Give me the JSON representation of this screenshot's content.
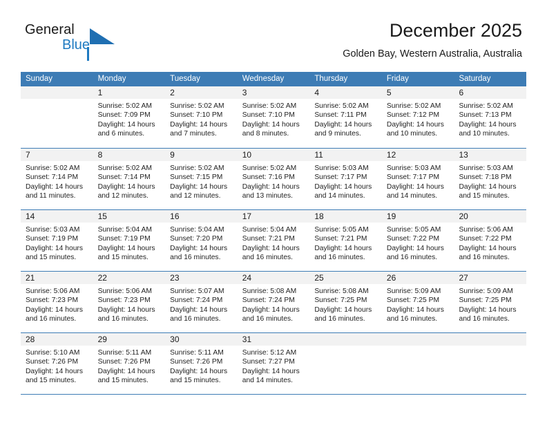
{
  "brand": {
    "name_part1": "General",
    "name_part2": "Blue",
    "mark_icon": "triangle-flag-icon",
    "accent_color": "#1f7ac1"
  },
  "header": {
    "title": "December 2025",
    "subtitle": "Golden Bay, Western Australia, Australia"
  },
  "calendar": {
    "header_bg_color": "#3d7cb5",
    "daynum_band_color": "#f2f2f2",
    "weekdays": [
      "Sunday",
      "Monday",
      "Tuesday",
      "Wednesday",
      "Thursday",
      "Friday",
      "Saturday"
    ],
    "weeks": [
      [
        {
          "day": "",
          "lines": []
        },
        {
          "day": "1",
          "lines": [
            "Sunrise: 5:02 AM",
            "Sunset: 7:09 PM",
            "Daylight: 14 hours",
            "and 6 minutes."
          ]
        },
        {
          "day": "2",
          "lines": [
            "Sunrise: 5:02 AM",
            "Sunset: 7:10 PM",
            "Daylight: 14 hours",
            "and 7 minutes."
          ]
        },
        {
          "day": "3",
          "lines": [
            "Sunrise: 5:02 AM",
            "Sunset: 7:10 PM",
            "Daylight: 14 hours",
            "and 8 minutes."
          ]
        },
        {
          "day": "4",
          "lines": [
            "Sunrise: 5:02 AM",
            "Sunset: 7:11 PM",
            "Daylight: 14 hours",
            "and 9 minutes."
          ]
        },
        {
          "day": "5",
          "lines": [
            "Sunrise: 5:02 AM",
            "Sunset: 7:12 PM",
            "Daylight: 14 hours",
            "and 10 minutes."
          ]
        },
        {
          "day": "6",
          "lines": [
            "Sunrise: 5:02 AM",
            "Sunset: 7:13 PM",
            "Daylight: 14 hours",
            "and 10 minutes."
          ]
        }
      ],
      [
        {
          "day": "7",
          "lines": [
            "Sunrise: 5:02 AM",
            "Sunset: 7:14 PM",
            "Daylight: 14 hours",
            "and 11 minutes."
          ]
        },
        {
          "day": "8",
          "lines": [
            "Sunrise: 5:02 AM",
            "Sunset: 7:14 PM",
            "Daylight: 14 hours",
            "and 12 minutes."
          ]
        },
        {
          "day": "9",
          "lines": [
            "Sunrise: 5:02 AM",
            "Sunset: 7:15 PM",
            "Daylight: 14 hours",
            "and 12 minutes."
          ]
        },
        {
          "day": "10",
          "lines": [
            "Sunrise: 5:02 AM",
            "Sunset: 7:16 PM",
            "Daylight: 14 hours",
            "and 13 minutes."
          ]
        },
        {
          "day": "11",
          "lines": [
            "Sunrise: 5:03 AM",
            "Sunset: 7:17 PM",
            "Daylight: 14 hours",
            "and 14 minutes."
          ]
        },
        {
          "day": "12",
          "lines": [
            "Sunrise: 5:03 AM",
            "Sunset: 7:17 PM",
            "Daylight: 14 hours",
            "and 14 minutes."
          ]
        },
        {
          "day": "13",
          "lines": [
            "Sunrise: 5:03 AM",
            "Sunset: 7:18 PM",
            "Daylight: 14 hours",
            "and 15 minutes."
          ]
        }
      ],
      [
        {
          "day": "14",
          "lines": [
            "Sunrise: 5:03 AM",
            "Sunset: 7:19 PM",
            "Daylight: 14 hours",
            "and 15 minutes."
          ]
        },
        {
          "day": "15",
          "lines": [
            "Sunrise: 5:04 AM",
            "Sunset: 7:19 PM",
            "Daylight: 14 hours",
            "and 15 minutes."
          ]
        },
        {
          "day": "16",
          "lines": [
            "Sunrise: 5:04 AM",
            "Sunset: 7:20 PM",
            "Daylight: 14 hours",
            "and 16 minutes."
          ]
        },
        {
          "day": "17",
          "lines": [
            "Sunrise: 5:04 AM",
            "Sunset: 7:21 PM",
            "Daylight: 14 hours",
            "and 16 minutes."
          ]
        },
        {
          "day": "18",
          "lines": [
            "Sunrise: 5:05 AM",
            "Sunset: 7:21 PM",
            "Daylight: 14 hours",
            "and 16 minutes."
          ]
        },
        {
          "day": "19",
          "lines": [
            "Sunrise: 5:05 AM",
            "Sunset: 7:22 PM",
            "Daylight: 14 hours",
            "and 16 minutes."
          ]
        },
        {
          "day": "20",
          "lines": [
            "Sunrise: 5:06 AM",
            "Sunset: 7:22 PM",
            "Daylight: 14 hours",
            "and 16 minutes."
          ]
        }
      ],
      [
        {
          "day": "21",
          "lines": [
            "Sunrise: 5:06 AM",
            "Sunset: 7:23 PM",
            "Daylight: 14 hours",
            "and 16 minutes."
          ]
        },
        {
          "day": "22",
          "lines": [
            "Sunrise: 5:06 AM",
            "Sunset: 7:23 PM",
            "Daylight: 14 hours",
            "and 16 minutes."
          ]
        },
        {
          "day": "23",
          "lines": [
            "Sunrise: 5:07 AM",
            "Sunset: 7:24 PM",
            "Daylight: 14 hours",
            "and 16 minutes."
          ]
        },
        {
          "day": "24",
          "lines": [
            "Sunrise: 5:08 AM",
            "Sunset: 7:24 PM",
            "Daylight: 14 hours",
            "and 16 minutes."
          ]
        },
        {
          "day": "25",
          "lines": [
            "Sunrise: 5:08 AM",
            "Sunset: 7:25 PM",
            "Daylight: 14 hours",
            "and 16 minutes."
          ]
        },
        {
          "day": "26",
          "lines": [
            "Sunrise: 5:09 AM",
            "Sunset: 7:25 PM",
            "Daylight: 14 hours",
            "and 16 minutes."
          ]
        },
        {
          "day": "27",
          "lines": [
            "Sunrise: 5:09 AM",
            "Sunset: 7:25 PM",
            "Daylight: 14 hours",
            "and 16 minutes."
          ]
        }
      ],
      [
        {
          "day": "28",
          "lines": [
            "Sunrise: 5:10 AM",
            "Sunset: 7:26 PM",
            "Daylight: 14 hours",
            "and 15 minutes."
          ]
        },
        {
          "day": "29",
          "lines": [
            "Sunrise: 5:11 AM",
            "Sunset: 7:26 PM",
            "Daylight: 14 hours",
            "and 15 minutes."
          ]
        },
        {
          "day": "30",
          "lines": [
            "Sunrise: 5:11 AM",
            "Sunset: 7:26 PM",
            "Daylight: 14 hours",
            "and 15 minutes."
          ]
        },
        {
          "day": "31",
          "lines": [
            "Sunrise: 5:12 AM",
            "Sunset: 7:27 PM",
            "Daylight: 14 hours",
            "and 14 minutes."
          ]
        },
        {
          "day": "",
          "lines": []
        },
        {
          "day": "",
          "lines": []
        },
        {
          "day": "",
          "lines": []
        }
      ]
    ]
  }
}
